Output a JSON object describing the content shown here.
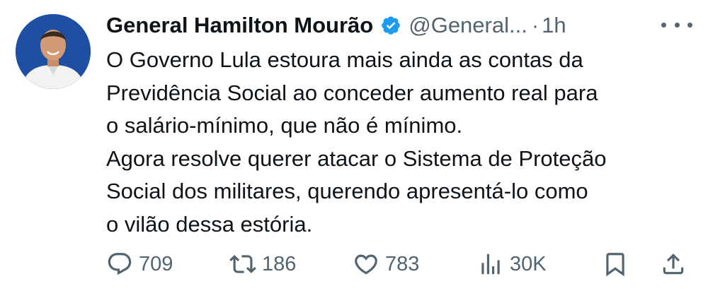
{
  "author": {
    "display_name": "General Hamilton Mourão",
    "handle": "@General...",
    "separator": "·",
    "time": "1h",
    "verified": true,
    "avatar_icon": "profile-photo"
  },
  "tweet": {
    "lines": [
      "O Governo Lula estoura mais ainda as contas da",
      "Previdência Social ao conceder aumento real para",
      "o salário-mínimo, que não é mínimo.",
      "Agora resolve querer atacar o Sistema de Proteção",
      "Social dos militares, querendo apresentá-lo como",
      "o vilão dessa estória."
    ]
  },
  "actions": {
    "replies": "709",
    "retweets": "186",
    "likes": "783",
    "views": "30K"
  },
  "colors": {
    "text": "#0f1419",
    "secondary": "#536471",
    "verified_badge": "#1d9bf0",
    "avatar_bg": "#1f4fa3"
  }
}
